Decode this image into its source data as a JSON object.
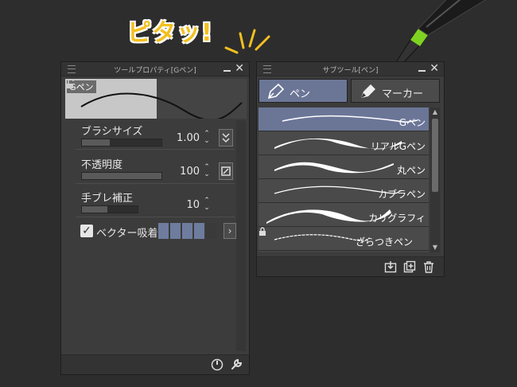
{
  "callout": {
    "text": "ピタッ!"
  },
  "tool_property": {
    "title": "ツールプロパティ[Gペン]",
    "preview_name": "Gペン",
    "props": [
      {
        "label": "ブラシサイズ",
        "value": "1.00",
        "level": 0.35
      },
      {
        "label": "不透明度",
        "value": "100",
        "level": 1.0
      },
      {
        "label": "手ブレ補正",
        "value": "10",
        "level": 0.45
      }
    ],
    "vector": {
      "label": "ベクター吸着",
      "checked": true,
      "check_glyph": "✓",
      "level_segments": 4,
      "total_segments": 5,
      "more_glyph": "›"
    }
  },
  "sub_tool": {
    "title": "サブツール[ペン]",
    "tabs": [
      {
        "label": "ペン",
        "active": true
      },
      {
        "label": "マーカー",
        "active": false
      }
    ],
    "items": [
      {
        "label": "Gペン",
        "selected": true,
        "locked": false
      },
      {
        "label": "リアルGペン",
        "selected": false,
        "locked": false
      },
      {
        "label": "丸ペン",
        "selected": false,
        "locked": false
      },
      {
        "label": "カブラペン",
        "selected": false,
        "locked": false
      },
      {
        "label": "カリグラフィ",
        "selected": false,
        "locked": false
      },
      {
        "label": "ざらつきペン",
        "selected": false,
        "locked": true
      }
    ]
  },
  "colors": {
    "accent": "#6b7697",
    "callout": "#f3c020",
    "stylus_ring": "#7ed321"
  }
}
